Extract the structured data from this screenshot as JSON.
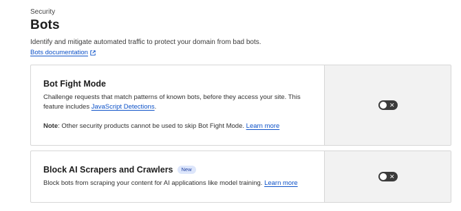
{
  "header": {
    "eyebrow": "Security",
    "title": "Bots",
    "subtitle": "Identify and mitigate automated traffic to protect your domain from bad bots.",
    "doc_link": "Bots documentation"
  },
  "cards": [
    {
      "title": "Bot Fight Mode",
      "desc_line1": "Challenge requests that match patterns of known bots, before they access your site. This",
      "desc_line2_prefix": "feature includes ",
      "desc_link": "JavaScript Detections",
      "desc_line2_suffix": ".",
      "note_label": "Note",
      "note_text": ": Other security products cannot be used to skip Bot Fight Mode. ",
      "note_link": "Learn more",
      "toggle": {
        "state": "off",
        "icon": "close-icon"
      }
    },
    {
      "title": "Block AI Scrapers and Crawlers",
      "badge": "New",
      "desc": "Block bots from scraping your content for AI applications like model training. ",
      "desc_link": "Learn more",
      "toggle": {
        "state": "off",
        "icon": "close-icon"
      }
    }
  ],
  "colors": {
    "link": "#0b50c7",
    "toggle_off": "#3b3b3b",
    "side_panel": "#f2f2f2",
    "badge_bg": "#dde6fb"
  }
}
